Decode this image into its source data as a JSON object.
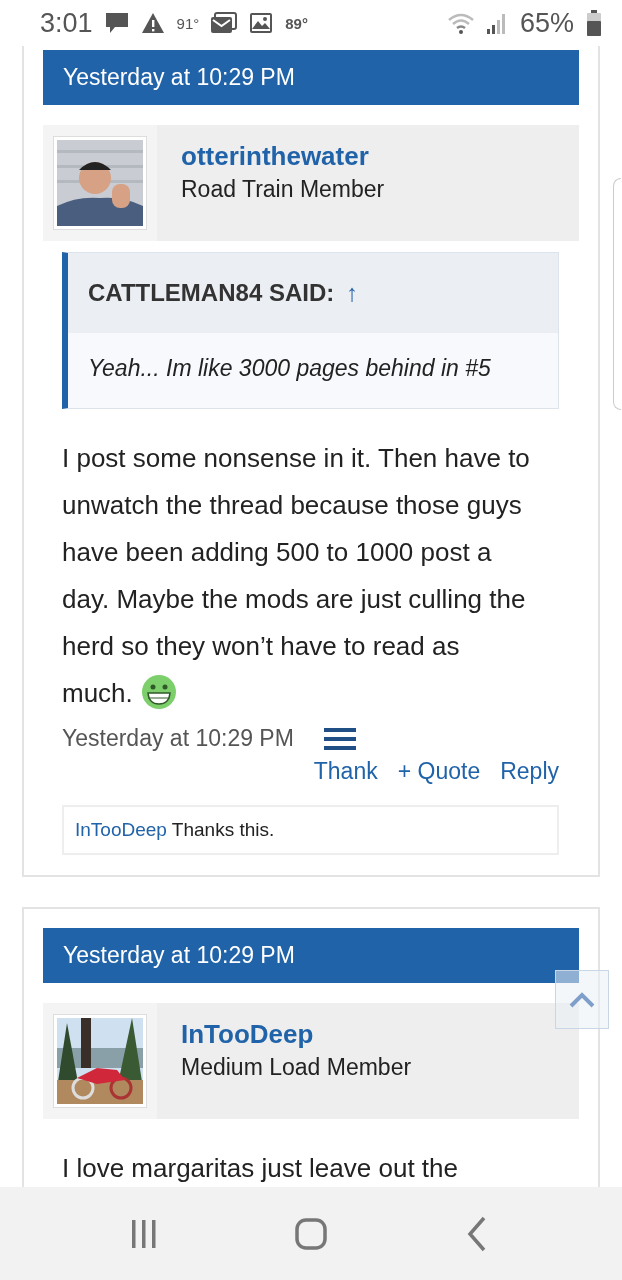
{
  "status_bar": {
    "time": "3:01",
    "temps": [
      "91°",
      "89°"
    ],
    "battery": "65%"
  },
  "posts": [
    {
      "date": "Yesterday at 10:29 PM",
      "author": {
        "name": "otterinthewater",
        "title": "Road Train Member"
      },
      "quote": {
        "header": "CATTLEMAN84 SAID:",
        "arrow": "↑",
        "text": "Yeah... Im like 3000 pages behind in #5"
      },
      "body": "I post some nonsense in it. Then have to unwatch the thread because those guys have been adding 500 to 1000 post a day. Maybe the mods are just culling the herd so they won’t have to read as much.",
      "trailing_emoji": true,
      "footer_date": "Yesterday at 10:29 PM",
      "actions": [
        "Thank",
        "+ Quote",
        "Reply"
      ],
      "likes": {
        "user": "InTooDeep",
        "text": "Thanks this."
      }
    },
    {
      "date": "Yesterday at 10:29 PM",
      "author": {
        "name": "InTooDeep",
        "title": "Medium Load Member"
      },
      "body": "I love margaritas just leave out the",
      "trailing_emoji": false
    }
  ]
}
